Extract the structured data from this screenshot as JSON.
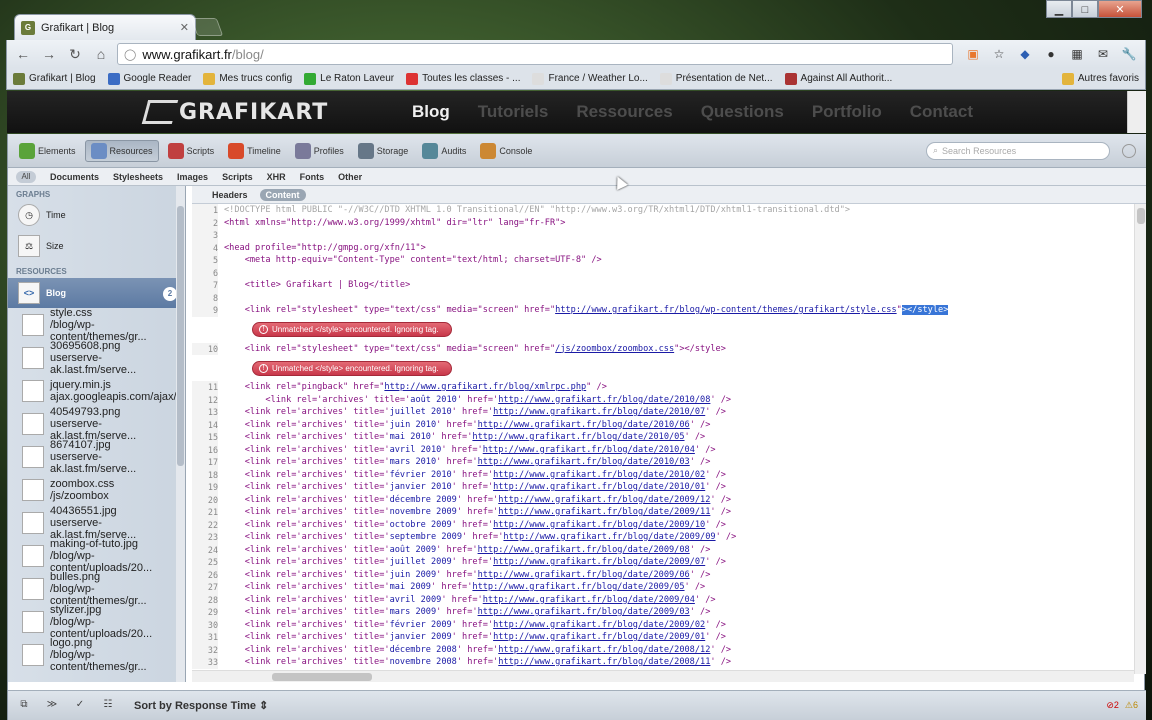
{
  "tab": {
    "title": "Grafikart | Blog"
  },
  "omnibox": {
    "host": "www.grafikart.fr",
    "path": "/blog/"
  },
  "bookmarks": [
    {
      "label": "Grafikart | Blog",
      "color": "#6b7b3a"
    },
    {
      "label": "Google Reader",
      "color": "#3b6cc4"
    },
    {
      "label": "Mes trucs config",
      "color": "#e3b43c"
    },
    {
      "label": "Le Raton Laveur",
      "color": "#33aa33"
    },
    {
      "label": "Toutes les classes - ...",
      "color": "#d33"
    },
    {
      "label": "France / Weather Lo...",
      "color": "#ddd"
    },
    {
      "label": "Présentation de Net...",
      "color": "#ddd"
    },
    {
      "label": "Against All Authorit...",
      "color": "#aa3333"
    }
  ],
  "bookmarks_other": "Autres favoris",
  "site": {
    "logo": "GRAFIKART",
    "nav": [
      "Blog",
      "Tutoriels",
      "Ressources",
      "Questions",
      "Portfolio",
      "Contact"
    ]
  },
  "devtools": {
    "panels": [
      "Elements",
      "Resources",
      "Scripts",
      "Timeline",
      "Profiles",
      "Storage",
      "Audits",
      "Console"
    ],
    "search_placeholder": "Search Resources",
    "filter_all": "All",
    "filters": [
      "Documents",
      "Stylesheets",
      "Images",
      "Scripts",
      "XHR",
      "Fonts",
      "Other"
    ],
    "graphs_header": "GRAPHS",
    "graph_time": "Time",
    "graph_size": "Size",
    "resources_header": "RESOURCES",
    "selected": "Blog",
    "selected_badge": "2",
    "resources": [
      {
        "name": "style.css",
        "sub": "/blog/wp-content/themes/gr..."
      },
      {
        "name": "30695608.png",
        "sub": "userserve-ak.last.fm/serve..."
      },
      {
        "name": "jquery.min.js",
        "sub": "ajax.googleapis.com/ajax/li..."
      },
      {
        "name": "40549793.png",
        "sub": "userserve-ak.last.fm/serve..."
      },
      {
        "name": "8674107.jpg",
        "sub": "userserve-ak.last.fm/serve..."
      },
      {
        "name": "zoombox.css",
        "sub": "/js/zoombox"
      },
      {
        "name": "40436551.jpg",
        "sub": "userserve-ak.last.fm/serve..."
      },
      {
        "name": "making-of-tuto.jpg",
        "sub": "/blog/wp-content/uploads/20..."
      },
      {
        "name": "bulles.png",
        "sub": "/blog/wp-content/themes/gr..."
      },
      {
        "name": "stylizer.jpg",
        "sub": "/blog/wp-content/uploads/20..."
      },
      {
        "name": "logo.png",
        "sub": "/blog/wp-content/themes/gr..."
      }
    ],
    "content_tabs": [
      "Headers",
      "Content"
    ],
    "error_text": "Unmatched </style> encountered.  Ignoring tag.",
    "sort_label": "Sort by Response Time",
    "errors": "2",
    "warnings": "6"
  },
  "code": {
    "l1": "<!DOCTYPE html PUBLIC \"-//W3C//DTD XHTML 1.0 Transitional//EN\" \"http://www.w3.org/TR/xhtml1/DTD/xhtml1-transitional.dtd\">",
    "l2": "<html xmlns=\"http://www.w3.org/1999/xhtml\" dir=\"ltr\" lang=\"fr-FR\">",
    "l4": "<head profile=\"http://gmpg.org/xfn/11\">",
    "l5": "    <meta http-equiv=\"Content-Type\" content=\"text/html; charset=UTF-8\" />",
    "l7": "    <title> Grafikart | Blog</title>",
    "l9a": "    <link rel=\"stylesheet\" type=\"text/css\" media=\"screen\" href=\"",
    "l9link": "http://www.grafikart.fr/blog/wp-content/themes/grafikart/style.css",
    "l9b": "\"",
    "l9hl": "></style>",
    "l10a": "    <link rel=\"stylesheet\" type=\"text/css\" media=\"screen\" href=\"",
    "l10link": "/js/zoombox/zoombox.css",
    "l10b": "\"></style>",
    "l11a": "    <link rel=\"pingback\" href=\"",
    "l11link": "http://www.grafikart.fr/blog/xmlrpc.php",
    "l11b": "\" />",
    "archives": [
      {
        "n": "12",
        "t": "août 2010",
        "u": "http://www.grafikart.fr/blog/date/2010/08",
        "i": "        "
      },
      {
        "n": "13",
        "t": "juillet 2010",
        "u": "http://www.grafikart.fr/blog/date/2010/07",
        "i": "    "
      },
      {
        "n": "14",
        "t": "juin 2010",
        "u": "http://www.grafikart.fr/blog/date/2010/06",
        "i": "    "
      },
      {
        "n": "15",
        "t": "mai 2010",
        "u": "http://www.grafikart.fr/blog/date/2010/05",
        "i": "    "
      },
      {
        "n": "16",
        "t": "avril 2010",
        "u": "http://www.grafikart.fr/blog/date/2010/04",
        "i": "    "
      },
      {
        "n": "17",
        "t": "mars 2010",
        "u": "http://www.grafikart.fr/blog/date/2010/03",
        "i": "    "
      },
      {
        "n": "18",
        "t": "février 2010",
        "u": "http://www.grafikart.fr/blog/date/2010/02",
        "i": "    "
      },
      {
        "n": "19",
        "t": "janvier 2010",
        "u": "http://www.grafikart.fr/blog/date/2010/01",
        "i": "    "
      },
      {
        "n": "20",
        "t": "décembre 2009",
        "u": "http://www.grafikart.fr/blog/date/2009/12",
        "i": "    "
      },
      {
        "n": "21",
        "t": "novembre 2009",
        "u": "http://www.grafikart.fr/blog/date/2009/11",
        "i": "    "
      },
      {
        "n": "22",
        "t": "octobre 2009",
        "u": "http://www.grafikart.fr/blog/date/2009/10",
        "i": "    "
      },
      {
        "n": "23",
        "t": "septembre 2009",
        "u": "http://www.grafikart.fr/blog/date/2009/09",
        "i": "    "
      },
      {
        "n": "24",
        "t": "août 2009",
        "u": "http://www.grafikart.fr/blog/date/2009/08",
        "i": "    "
      },
      {
        "n": "25",
        "t": "juillet 2009",
        "u": "http://www.grafikart.fr/blog/date/2009/07",
        "i": "    "
      },
      {
        "n": "26",
        "t": "juin 2009",
        "u": "http://www.grafikart.fr/blog/date/2009/06",
        "i": "    "
      },
      {
        "n": "27",
        "t": "mai 2009",
        "u": "http://www.grafikart.fr/blog/date/2009/05",
        "i": "    "
      },
      {
        "n": "28",
        "t": "avril 2009",
        "u": "http://www.grafikart.fr/blog/date/2009/04",
        "i": "    "
      },
      {
        "n": "29",
        "t": "mars 2009",
        "u": "http://www.grafikart.fr/blog/date/2009/03",
        "i": "    "
      },
      {
        "n": "30",
        "t": "février 2009",
        "u": "http://www.grafikart.fr/blog/date/2009/02",
        "i": "    "
      },
      {
        "n": "31",
        "t": "janvier 2009",
        "u": "http://www.grafikart.fr/blog/date/2009/01",
        "i": "    "
      },
      {
        "n": "32",
        "t": "décembre 2008",
        "u": "http://www.grafikart.fr/blog/date/2008/12",
        "i": "    "
      },
      {
        "n": "33",
        "t": "novembre 2008",
        "u": "http://www.grafikart.fr/blog/date/2008/11",
        "i": "    "
      }
    ]
  }
}
